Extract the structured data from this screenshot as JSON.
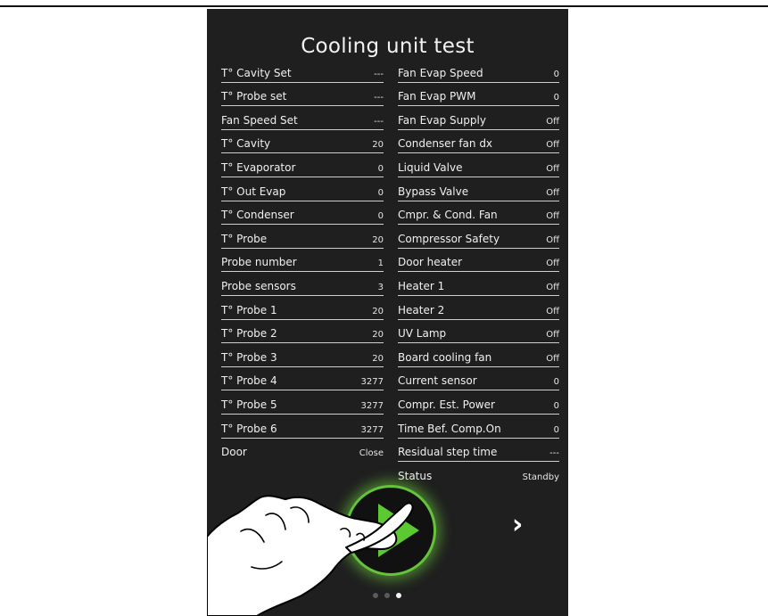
{
  "title": "Cooling unit test",
  "left_rows": [
    {
      "label": "T° Cavity Set",
      "value": "---"
    },
    {
      "label": "T° Probe set",
      "value": "---"
    },
    {
      "label": "Fan Speed Set",
      "value": "---"
    },
    {
      "label": "T° Cavity",
      "value": "20"
    },
    {
      "label": "T° Evaporator",
      "value": "0"
    },
    {
      "label": "T° Out Evap",
      "value": "0"
    },
    {
      "label": "T° Condenser",
      "value": "0"
    },
    {
      "label": "T° Probe",
      "value": "20"
    },
    {
      "label": "Probe number",
      "value": "1"
    },
    {
      "label": "Probe sensors",
      "value": "3"
    },
    {
      "label": "T° Probe 1",
      "value": "20"
    },
    {
      "label": "T° Probe 2",
      "value": "20"
    },
    {
      "label": "T° Probe 3",
      "value": "20"
    },
    {
      "label": "T° Probe 4",
      "value": "3277"
    },
    {
      "label": "T° Probe 5",
      "value": "3277"
    },
    {
      "label": "T° Probe 6",
      "value": "3277"
    },
    {
      "label": "Door",
      "value": "Close"
    }
  ],
  "right_rows": [
    {
      "label": "Fan Evap Speed",
      "value": "0"
    },
    {
      "label": "Fan Evap PWM",
      "value": "0"
    },
    {
      "label": "Fan Evap Supply",
      "value": "Off"
    },
    {
      "label": "Condenser fan dx",
      "value": "Off"
    },
    {
      "label": "Liquid Valve",
      "value": "Off"
    },
    {
      "label": "Bypass Valve",
      "value": "Off"
    },
    {
      "label": "Cmpr. & Cond. Fan",
      "value": "Off"
    },
    {
      "label": "Compressor Safety",
      "value": "Off"
    },
    {
      "label": "Door heater",
      "value": "Off"
    },
    {
      "label": "Heater 1",
      "value": "Off"
    },
    {
      "label": "Heater 2",
      "value": "Off"
    },
    {
      "label": "UV Lamp",
      "value": "Off"
    },
    {
      "label": "Board cooling fan",
      "value": "Off"
    },
    {
      "label": "Current sensor",
      "value": "0"
    },
    {
      "label": "Compr. Est. Power",
      "value": "0"
    },
    {
      "label": "Time Bef. Comp.On",
      "value": "0"
    },
    {
      "label": "Residual step time",
      "value": "---"
    },
    {
      "label": "Status",
      "value": "Standby"
    }
  ],
  "nav": {
    "prev_glyph": "‹",
    "next_glyph": "›"
  },
  "pager": {
    "pages": 3,
    "active": 3
  },
  "icons": {
    "play": "play-icon",
    "hand": "pointing-hand-icon"
  },
  "colors": {
    "panel": "#1f1f1f",
    "accent": "#64c23b",
    "play": "#5cc832",
    "text": "#f0f0f0"
  }
}
